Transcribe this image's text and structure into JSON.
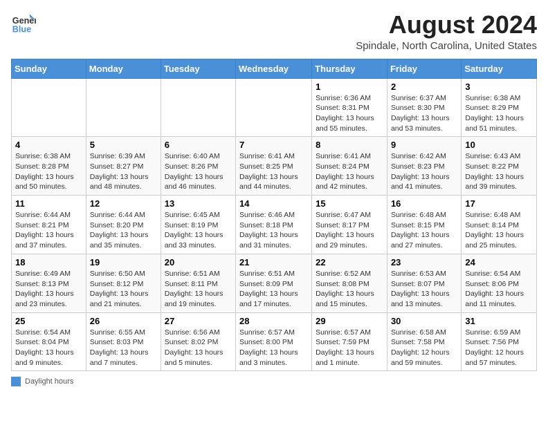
{
  "header": {
    "logo_line1": "General",
    "logo_line2": "Blue",
    "main_title": "August 2024",
    "subtitle": "Spindale, North Carolina, United States"
  },
  "calendar": {
    "days_of_week": [
      "Sunday",
      "Monday",
      "Tuesday",
      "Wednesday",
      "Thursday",
      "Friday",
      "Saturday"
    ],
    "weeks": [
      [
        {
          "day": "",
          "info": ""
        },
        {
          "day": "",
          "info": ""
        },
        {
          "day": "",
          "info": ""
        },
        {
          "day": "",
          "info": ""
        },
        {
          "day": "1",
          "info": "Sunrise: 6:36 AM\nSunset: 8:31 PM\nDaylight: 13 hours\nand 55 minutes."
        },
        {
          "day": "2",
          "info": "Sunrise: 6:37 AM\nSunset: 8:30 PM\nDaylight: 13 hours\nand 53 minutes."
        },
        {
          "day": "3",
          "info": "Sunrise: 6:38 AM\nSunset: 8:29 PM\nDaylight: 13 hours\nand 51 minutes."
        }
      ],
      [
        {
          "day": "4",
          "info": "Sunrise: 6:38 AM\nSunset: 8:28 PM\nDaylight: 13 hours\nand 50 minutes."
        },
        {
          "day": "5",
          "info": "Sunrise: 6:39 AM\nSunset: 8:27 PM\nDaylight: 13 hours\nand 48 minutes."
        },
        {
          "day": "6",
          "info": "Sunrise: 6:40 AM\nSunset: 8:26 PM\nDaylight: 13 hours\nand 46 minutes."
        },
        {
          "day": "7",
          "info": "Sunrise: 6:41 AM\nSunset: 8:25 PM\nDaylight: 13 hours\nand 44 minutes."
        },
        {
          "day": "8",
          "info": "Sunrise: 6:41 AM\nSunset: 8:24 PM\nDaylight: 13 hours\nand 42 minutes."
        },
        {
          "day": "9",
          "info": "Sunrise: 6:42 AM\nSunset: 8:23 PM\nDaylight: 13 hours\nand 41 minutes."
        },
        {
          "day": "10",
          "info": "Sunrise: 6:43 AM\nSunset: 8:22 PM\nDaylight: 13 hours\nand 39 minutes."
        }
      ],
      [
        {
          "day": "11",
          "info": "Sunrise: 6:44 AM\nSunset: 8:21 PM\nDaylight: 13 hours\nand 37 minutes."
        },
        {
          "day": "12",
          "info": "Sunrise: 6:44 AM\nSunset: 8:20 PM\nDaylight: 13 hours\nand 35 minutes."
        },
        {
          "day": "13",
          "info": "Sunrise: 6:45 AM\nSunset: 8:19 PM\nDaylight: 13 hours\nand 33 minutes."
        },
        {
          "day": "14",
          "info": "Sunrise: 6:46 AM\nSunset: 8:18 PM\nDaylight: 13 hours\nand 31 minutes."
        },
        {
          "day": "15",
          "info": "Sunrise: 6:47 AM\nSunset: 8:17 PM\nDaylight: 13 hours\nand 29 minutes."
        },
        {
          "day": "16",
          "info": "Sunrise: 6:48 AM\nSunset: 8:15 PM\nDaylight: 13 hours\nand 27 minutes."
        },
        {
          "day": "17",
          "info": "Sunrise: 6:48 AM\nSunset: 8:14 PM\nDaylight: 13 hours\nand 25 minutes."
        }
      ],
      [
        {
          "day": "18",
          "info": "Sunrise: 6:49 AM\nSunset: 8:13 PM\nDaylight: 13 hours\nand 23 minutes."
        },
        {
          "day": "19",
          "info": "Sunrise: 6:50 AM\nSunset: 8:12 PM\nDaylight: 13 hours\nand 21 minutes."
        },
        {
          "day": "20",
          "info": "Sunrise: 6:51 AM\nSunset: 8:11 PM\nDaylight: 13 hours\nand 19 minutes."
        },
        {
          "day": "21",
          "info": "Sunrise: 6:51 AM\nSunset: 8:09 PM\nDaylight: 13 hours\nand 17 minutes."
        },
        {
          "day": "22",
          "info": "Sunrise: 6:52 AM\nSunset: 8:08 PM\nDaylight: 13 hours\nand 15 minutes."
        },
        {
          "day": "23",
          "info": "Sunrise: 6:53 AM\nSunset: 8:07 PM\nDaylight: 13 hours\nand 13 minutes."
        },
        {
          "day": "24",
          "info": "Sunrise: 6:54 AM\nSunset: 8:06 PM\nDaylight: 13 hours\nand 11 minutes."
        }
      ],
      [
        {
          "day": "25",
          "info": "Sunrise: 6:54 AM\nSunset: 8:04 PM\nDaylight: 13 hours\nand 9 minutes."
        },
        {
          "day": "26",
          "info": "Sunrise: 6:55 AM\nSunset: 8:03 PM\nDaylight: 13 hours\nand 7 minutes."
        },
        {
          "day": "27",
          "info": "Sunrise: 6:56 AM\nSunset: 8:02 PM\nDaylight: 13 hours\nand 5 minutes."
        },
        {
          "day": "28",
          "info": "Sunrise: 6:57 AM\nSunset: 8:00 PM\nDaylight: 13 hours\nand 3 minutes."
        },
        {
          "day": "29",
          "info": "Sunrise: 6:57 AM\nSunset: 7:59 PM\nDaylight: 13 hours\nand 1 minute."
        },
        {
          "day": "30",
          "info": "Sunrise: 6:58 AM\nSunset: 7:58 PM\nDaylight: 12 hours\nand 59 minutes."
        },
        {
          "day": "31",
          "info": "Sunrise: 6:59 AM\nSunset: 7:56 PM\nDaylight: 12 hours\nand 57 minutes."
        }
      ]
    ]
  },
  "footer": {
    "legend_label": "Daylight hours"
  }
}
